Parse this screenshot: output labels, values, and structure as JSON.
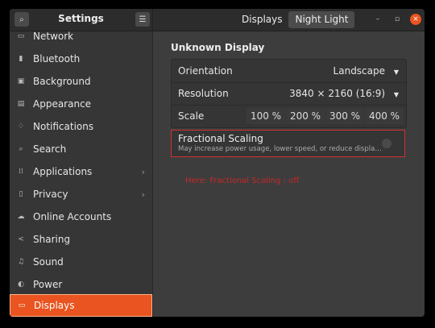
{
  "header": {
    "title": "Settings",
    "tabs": [
      "Displays",
      "Night Light"
    ],
    "active_tab": "Night Light"
  },
  "sidebar": {
    "items": [
      {
        "label": "Network",
        "icon": "network-icon",
        "glyph": "▭"
      },
      {
        "label": "Bluetooth",
        "icon": "bluetooth-icon",
        "glyph": "▮"
      },
      {
        "label": "Background",
        "icon": "background-icon",
        "glyph": "▣"
      },
      {
        "label": "Appearance",
        "icon": "appearance-icon",
        "glyph": "▤"
      },
      {
        "label": "Notifications",
        "icon": "notifications-icon",
        "glyph": "♢"
      },
      {
        "label": "Search",
        "icon": "search-icon",
        "glyph": "⌕"
      },
      {
        "label": "Applications",
        "icon": "applications-icon",
        "glyph": "⁞⁞",
        "chevron": "›"
      },
      {
        "label": "Privacy",
        "icon": "privacy-icon",
        "glyph": "▯",
        "chevron": "›"
      },
      {
        "label": "Online Accounts",
        "icon": "online-accounts-icon",
        "glyph": "☁"
      },
      {
        "label": "Sharing",
        "icon": "sharing-icon",
        "glyph": "<"
      },
      {
        "label": "Sound",
        "icon": "sound-icon",
        "glyph": "♫"
      },
      {
        "label": "Power",
        "icon": "power-icon",
        "glyph": "◐"
      },
      {
        "label": "Displays",
        "icon": "displays-icon",
        "glyph": "▭",
        "selected": true
      }
    ]
  },
  "main": {
    "section_title": "Unknown Display",
    "orientation": {
      "label": "Orientation",
      "value": "Landscape"
    },
    "resolution": {
      "label": "Resolution",
      "value": "3840 × 2160 (16:9)"
    },
    "scale": {
      "label": "Scale",
      "options": [
        "100 %",
        "200 %",
        "300 %",
        "400 %"
      ]
    },
    "fractional_scaling": {
      "title": "Fractional Scaling",
      "subtitle": "May increase power usage, lower speed, or reduce displa…",
      "enabled": false
    }
  },
  "annotation": "Here: Fractional Scaling : off",
  "colors": {
    "accent": "#e95420",
    "highlight_border": "#d32f2f"
  }
}
